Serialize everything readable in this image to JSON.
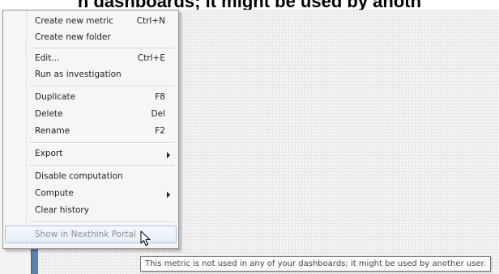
{
  "banner": {
    "text": "n dashboards; it might be used by anoth"
  },
  "context_menu": {
    "items": [
      {
        "label": "Create new metric",
        "shortcut": "Ctrl+N"
      },
      {
        "label": "Create new folder",
        "shortcut": ""
      },
      {
        "label": "Edit...",
        "shortcut": "Ctrl+E"
      },
      {
        "label": "Run as investigation",
        "shortcut": ""
      },
      {
        "label": "Duplicate",
        "shortcut": "F8"
      },
      {
        "label": "Delete",
        "shortcut": "Del"
      },
      {
        "label": "Rename",
        "shortcut": "F2"
      },
      {
        "label": "Export",
        "shortcut": ""
      },
      {
        "label": "Disable computation",
        "shortcut": ""
      },
      {
        "label": "Compute",
        "shortcut": ""
      },
      {
        "label": "Clear history",
        "shortcut": ""
      },
      {
        "label": "Show in Nexthink Portal",
        "shortcut": ""
      }
    ]
  },
  "tooltip": {
    "text": "This metric is not used in any of your dashboards; it might be used by another user."
  },
  "icons": {
    "submenu_arrow": "triangle-right-icon",
    "mouse_cursor": "arrow-cursor-icon"
  },
  "colors": {
    "highlight_border": "#a8c4e0",
    "disabled_text": "#8e8e8e",
    "strip_blue": "#5b7fb4"
  }
}
